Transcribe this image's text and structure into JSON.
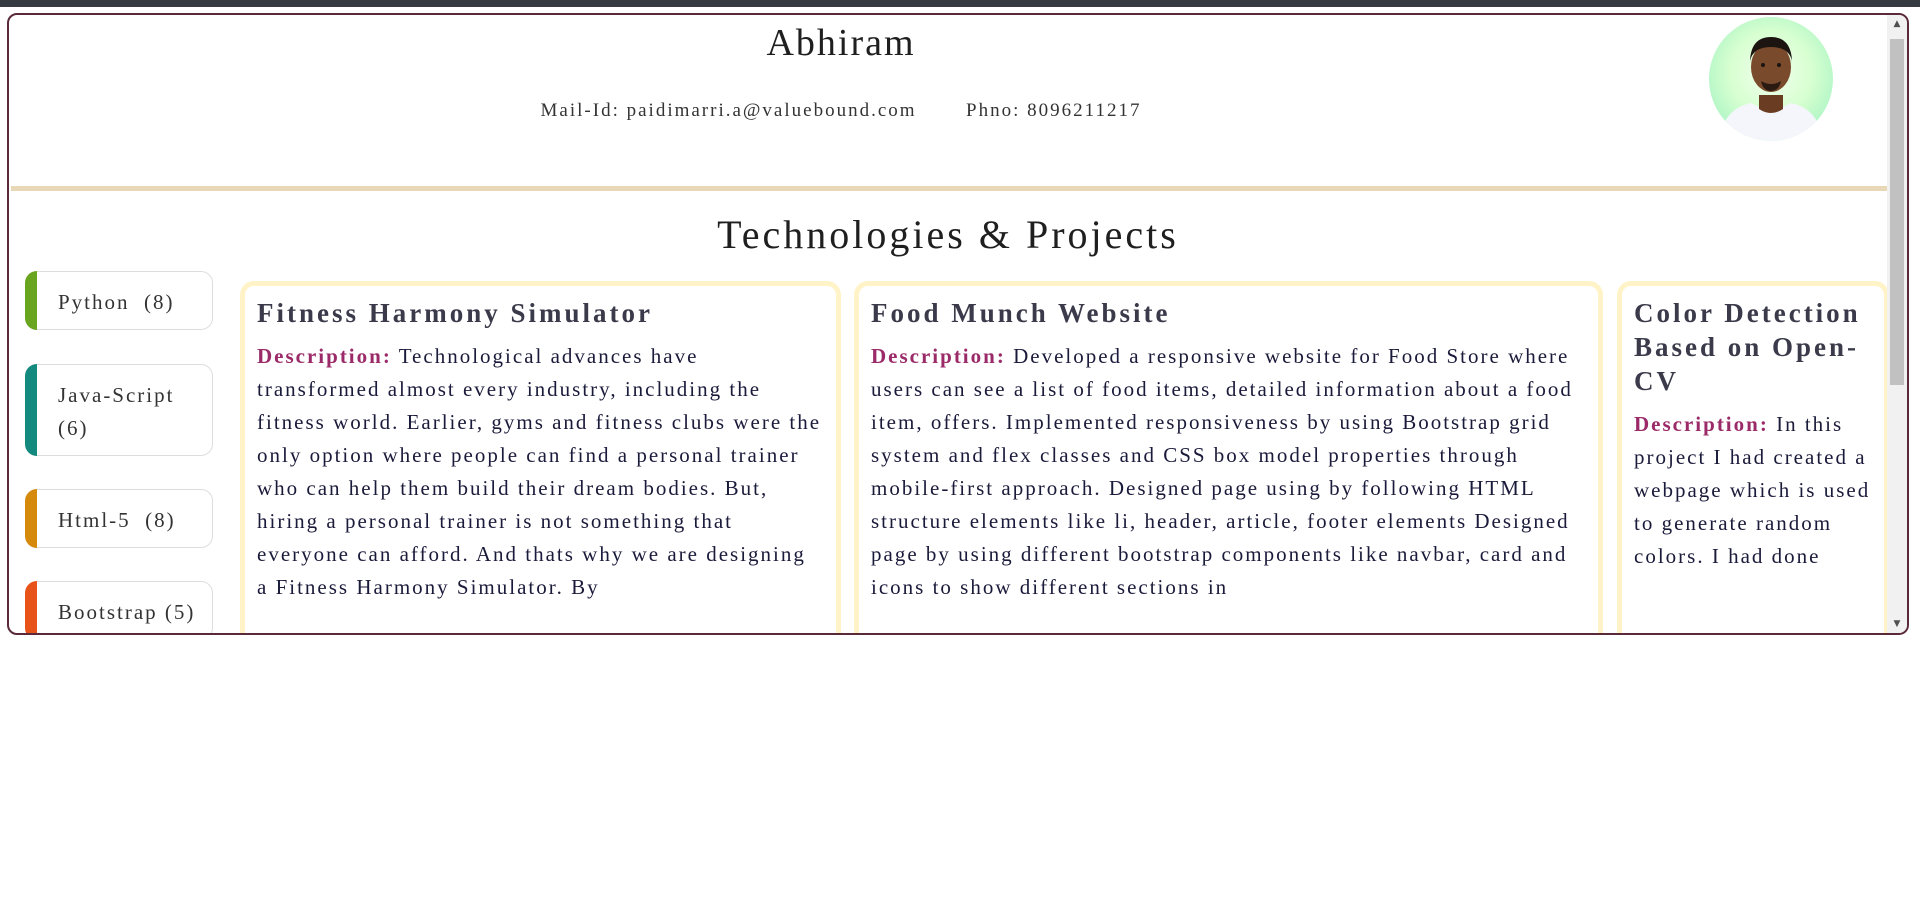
{
  "profile": {
    "name": "Abhiram",
    "mail_label": "Mail-Id:",
    "mail_value": "paidimarri.a@valuebound.com",
    "phone_label": "Phno:",
    "phone_value": "8096211217",
    "avatar_icon": "person-photo"
  },
  "section": {
    "title": "Technologies & Projects"
  },
  "technologies": [
    {
      "label": "Python  (8)",
      "color": "#6aa51f"
    },
    {
      "label": "Java-Script (6)",
      "color": "#148a7e"
    },
    {
      "label": "Html-5  (8)",
      "color": "#d68a0c"
    },
    {
      "label": "Bootstrap (5)",
      "color": "#e8531a"
    }
  ],
  "projects": [
    {
      "title": "Fitness Harmony Simulator",
      "desc_label": "Description:",
      "desc": " Technological advances have transformed almost every industry, including the fitness world. Earlier, gyms and fitness clubs were the only option where people can find a personal trainer who can help them build their dream bodies. But, hiring a personal trainer is not something that everyone can afford. And thats why we are designing a Fitness Harmony Simulator. By"
    },
    {
      "title": "Food Munch Website",
      "desc_label": "Description:",
      "desc": " Developed a responsive website for Food Store where users can see a list of food items, detailed information about a food item, offers. Implemented responsiveness by using Bootstrap grid system and flex classes and CSS box model properties through mobile-first approach. Designed page using by following HTML structure elements like li, header, article, footer elements Designed page by using different bootstrap components like navbar, card and icons to show different sections in"
    },
    {
      "title": "Color Detection Based on Open-CV",
      "desc_label": "Description:",
      "desc": " In this project I had created a webpage which is used to generate random colors. I had done"
    }
  ],
  "colors": {
    "frame_border": "#5b2a3a",
    "divider": "#e8d8b7",
    "card_border": "#fff3c7",
    "desc_label": "#9b2a69"
  }
}
